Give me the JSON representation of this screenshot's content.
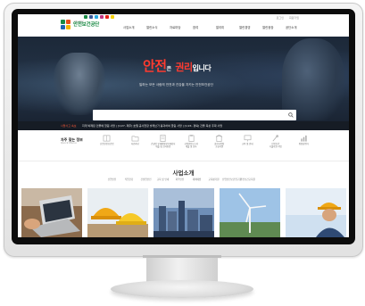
{
  "site": {
    "logo_sub": "고용노동부",
    "logo_name": "안전보건공단",
    "util_links": [
      "로그인",
      "회원가입"
    ],
    "nav": [
      "사업소개",
      "열린소식",
      "자료마당",
      "참여",
      "알리미",
      "열린경영",
      "열린광장",
      "공단소개"
    ]
  },
  "hero": {
    "title_a": "안전",
    "title_b": "은",
    "title_c": "권리",
    "title_d": "입니다",
    "subtitle": "일하는 모든 사람의 안전과 건강을 지키는 안전보건공단"
  },
  "search": {
    "placeholder": ""
  },
  "notice": {
    "label": "사망사고 속보",
    "text": "지게 박제된 인물에 깔림 사망 | [1/27, 제주] 호텔 공사현장 슬래브가 붕괴하여 깔림 사망 | [1/24, 경북] 건물 옥상 추락 사망"
  },
  "quick_menu": {
    "title": "자주 찾는 정보",
    "subtitle": "Quick Menu",
    "items": [
      {
        "label": "산업안전보건법",
        "icon": "book-icon"
      },
      {
        "label": "자료마당",
        "icon": "folder-icon"
      },
      {
        "label": "건설업 유해위험방지계획서\n제출 및 심사방법",
        "icon": "document-icon"
      },
      {
        "label": "공정안전보고서\n제출 및 심사",
        "icon": "clipboard-icon"
      },
      {
        "label": "클린사업장\n조성지원",
        "icon": "building-icon"
      },
      {
        "label": "교육 및 안내",
        "icon": "monitor-icon"
      },
      {
        "label": "안전보건\n기술지원 사업",
        "icon": "tools-icon"
      },
      {
        "label": "위험성평가",
        "icon": "chart-icon"
      }
    ]
  },
  "business": {
    "title": "사업소개",
    "tabs": [
      "산업안전",
      "직업건강",
      "건설업안전",
      "교육 및 안내",
      "화학안전",
      "재해예방",
      "교육평가원",
      "산업안전보건연구원",
      "안전보건교육원"
    ],
    "cards": [
      "laptop-photo",
      "hard-hats-photo",
      "city-photo",
      "wind-turbine-photo",
      "worker-photo"
    ]
  },
  "colors": {
    "brand_green": "#1a8a44",
    "hero_red": "#ff3b2f",
    "hero_bg": "#1f2c3d"
  }
}
